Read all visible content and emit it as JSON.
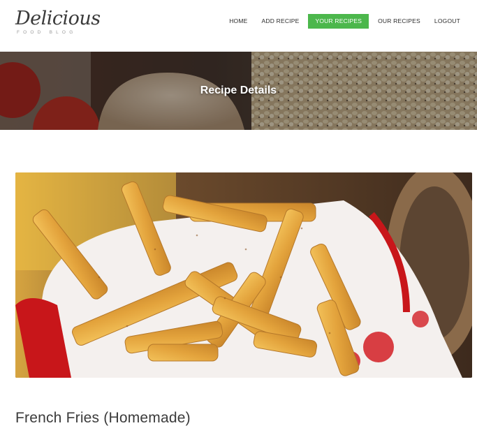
{
  "brand": {
    "name": "Delicious",
    "tagline": "FOOD BLOG"
  },
  "nav": {
    "items": [
      {
        "label": "HOME",
        "active": false
      },
      {
        "label": "ADD RECIPE",
        "active": false
      },
      {
        "label": "YOUR RECIPES",
        "active": true
      },
      {
        "label": "OUR RECIPES",
        "active": false
      },
      {
        "label": "LOGOUT",
        "active": false
      }
    ]
  },
  "hero": {
    "title": "Recipe Details"
  },
  "recipe": {
    "title": "French Fries (Homemade)",
    "image_alt": "french-fries-photo"
  },
  "colors": {
    "accent": "#4cb74c",
    "text": "#3b3b3b"
  }
}
